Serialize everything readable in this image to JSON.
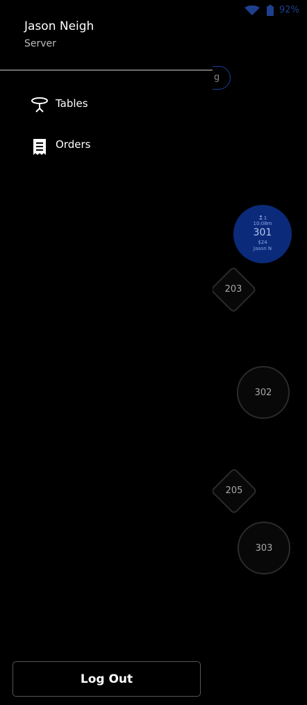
{
  "status_bar": {
    "battery_percent": "92%",
    "icons": [
      "wifi-icon",
      "battery-icon"
    ]
  },
  "floor": {
    "pill_label": "g",
    "tables": {
      "t203": "203",
      "t205": "205",
      "t302": "302",
      "t303": "303",
      "t301": {
        "guests": "1",
        "time": "10:08m",
        "number": "301",
        "amount": "$24",
        "server": "Jason N"
      }
    }
  },
  "drawer": {
    "user_name": "Jason Neigh",
    "user_role": "Server",
    "nav": [
      {
        "label": "Tables",
        "icon": "table-icon"
      },
      {
        "label": "Orders",
        "icon": "receipt-icon"
      }
    ],
    "logout_label": "Log Out"
  },
  "colors": {
    "background": "#000000",
    "accent_blue": "#0b2a7a",
    "status_blue": "#1f3f8f"
  }
}
